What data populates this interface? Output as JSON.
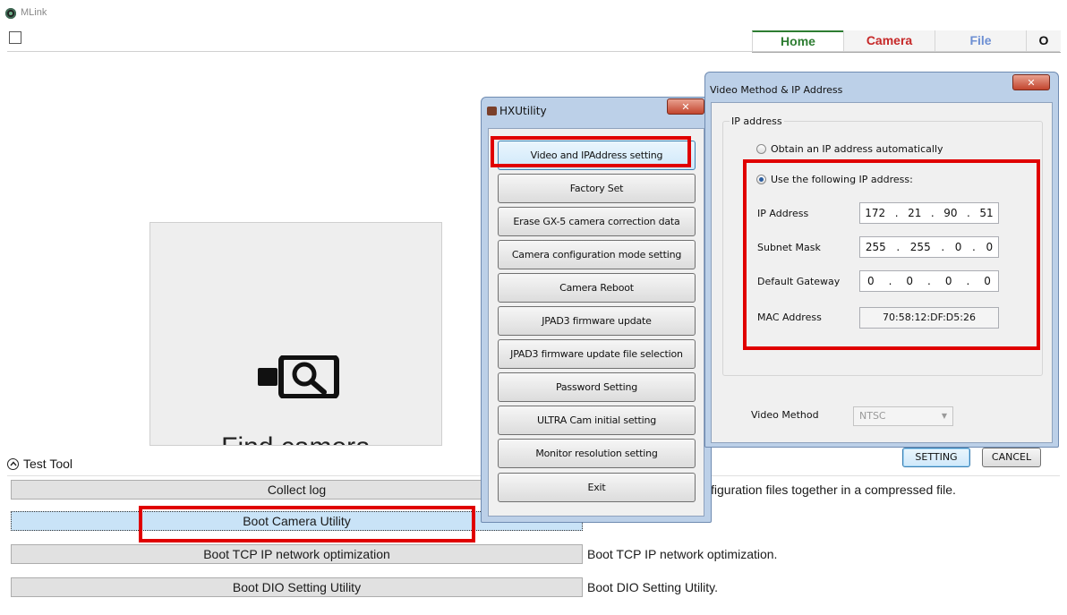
{
  "app": {
    "title": "MLink"
  },
  "tabs": [
    {
      "label": "Home",
      "color": "#2e7d32"
    },
    {
      "label": "Camera",
      "color": "#c62828"
    },
    {
      "label": "File",
      "color": "#6d8fd3"
    },
    {
      "label": "O",
      "color": "#111111"
    }
  ],
  "find_camera": {
    "label": "Find camera",
    "icon": "camera-search-icon"
  },
  "test_tool": {
    "title": "Test Tool",
    "buttons": [
      {
        "label": "Collect log",
        "description": "figuration files together in a compressed file."
      },
      {
        "label": "Boot Camera Utility",
        "description": ""
      },
      {
        "label": "Boot TCP IP network optimization",
        "description": "Boot TCP IP network optimization."
      },
      {
        "label": "Boot DIO Setting Utility",
        "description": "Boot DIO Setting Utility."
      }
    ]
  },
  "hxutility": {
    "title": "HXUtility",
    "buttons": [
      "Video and IPAddress setting",
      "Factory Set",
      "Erase GX-5 camera correction data",
      "Camera configuration mode setting",
      "Camera Reboot",
      "JPAD3 firmware update",
      "JPAD3 firmware update file selection",
      "Password Setting",
      "ULTRA Cam initial setting",
      "Monitor resolution setting",
      "Exit"
    ]
  },
  "video_dialog": {
    "title": "Video Method & IP Address",
    "group_label": "IP address",
    "radio_auto": "Obtain an IP address automatically",
    "radio_manual": "Use the following IP address:",
    "selected_radio": "manual",
    "ip_address": {
      "label": "IP Address",
      "octets": [
        "172",
        "21",
        "90",
        "51"
      ]
    },
    "subnet_mask": {
      "label": "Subnet Mask",
      "octets": [
        "255",
        "255",
        "0",
        "0"
      ]
    },
    "default_gateway": {
      "label": "Default Gateway",
      "octets": [
        "0",
        "0",
        "0",
        "0"
      ]
    },
    "mac_address": {
      "label": "MAC Address",
      "value": "70:58:12:DF:D5:26"
    },
    "video_method": {
      "label": "Video Method",
      "value": "NTSC"
    },
    "setting_button": "SETTING",
    "cancel_button": "CANCEL"
  },
  "highlight_color": "#e00000"
}
